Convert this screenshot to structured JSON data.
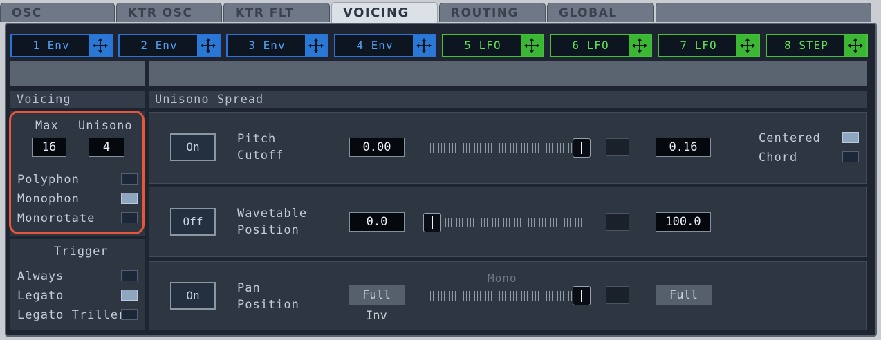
{
  "tabs": [
    {
      "label": "OSC",
      "active": false
    },
    {
      "label": "KTR OSC",
      "active": false
    },
    {
      "label": "KTR FLT",
      "active": false
    },
    {
      "label": "VOICING",
      "active": true
    },
    {
      "label": "ROUTING",
      "active": false
    },
    {
      "label": "GLOBAL",
      "active": false
    }
  ],
  "modulators": [
    {
      "label": "1 Env",
      "color": "blue"
    },
    {
      "label": "2 Env",
      "color": "blue"
    },
    {
      "label": "3 Env",
      "color": "blue"
    },
    {
      "label": "4 Env",
      "color": "blue"
    },
    {
      "label": "5 LFO",
      "color": "green"
    },
    {
      "label": "6 LFO",
      "color": "green"
    },
    {
      "label": "7 LFO",
      "color": "green"
    },
    {
      "label": "8 STEP",
      "color": "green"
    }
  ],
  "voicing": {
    "header": "Voicing",
    "max_label": "Max",
    "unisono_label": "Unisono",
    "max_value": "16",
    "unisono_value": "4",
    "modes": [
      {
        "label": "Polyphon",
        "checked": false
      },
      {
        "label": "Monophon",
        "checked": true
      },
      {
        "label": "Monorotate",
        "checked": false
      }
    ],
    "highlight_color": "#e8553a"
  },
  "trigger": {
    "header": "Trigger",
    "options": [
      {
        "label": "Always",
        "checked": false
      },
      {
        "label": "Legato",
        "checked": true
      },
      {
        "label": "Legato Triller",
        "checked": false
      }
    ]
  },
  "spread": {
    "header": "Unisono Spread",
    "rows": [
      {
        "toggle": "On",
        "line1": "Pitch",
        "line2": "Cutoff",
        "value": "0.00",
        "slider_level": 1.0,
        "right_value": "0.16"
      },
      {
        "toggle": "Off",
        "line1": "Wavetable",
        "line2": "Position",
        "value": "0.0",
        "slider_level": 0.0,
        "right_value": "100.0"
      },
      {
        "toggle": "On",
        "line1": "Pan",
        "line2": "Position",
        "value": "Full Inv",
        "slider_level": 1.0,
        "right_value": "Full",
        "slider_caption": "Mono"
      }
    ],
    "centered_label": "Centered",
    "chord_label": "Chord",
    "centered_checked": true,
    "chord_checked": false
  },
  "colors": {
    "blue": "#2b72d8",
    "green": "#42c13a",
    "accent": "#e8553a"
  }
}
